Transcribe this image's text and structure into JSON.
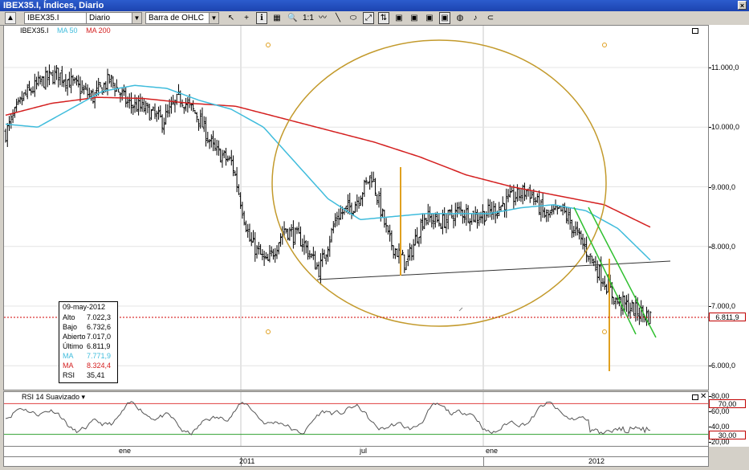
{
  "window": {
    "title": "IBEX35.I, Índices, Diario",
    "close_glyph": "×"
  },
  "toolbar": {
    "symbol": "IBEX35.I",
    "period": "Diario",
    "chart_type": "Barra de OHLC",
    "tool_glyphs": [
      "↖",
      "+",
      "ℹ",
      "▦",
      "🔍",
      "1:1",
      "〰",
      "╲",
      "⬭",
      "⤢",
      "⇅",
      "▣",
      "▣",
      "▣",
      "▣",
      "◍",
      "♪",
      "⊂"
    ]
  },
  "legend": {
    "symbol": "IBEX35.I",
    "ma50": "MA 50",
    "ma200": "MA 200",
    "ma50_color": "#3fbcdc",
    "ma200_color": "#d42020"
  },
  "infobox": {
    "date": "09-may-2012",
    "rows": [
      {
        "label": "Alto",
        "value": "7.022,3",
        "color": "#000000"
      },
      {
        "label": "Bajo",
        "value": "6.732,6",
        "color": "#000000"
      },
      {
        "label": "Abierto",
        "value": "7.017,0",
        "color": "#000000"
      },
      {
        "label": "Último",
        "value": "6.811,9",
        "color": "#000000"
      },
      {
        "label": "MA",
        "value": "7.771,9",
        "color": "#3fbcdc"
      },
      {
        "label": "MA",
        "value": "8.324,4",
        "color": "#d42020"
      },
      {
        "label": "RSI",
        "value": "35,41",
        "color": "#000000"
      }
    ]
  },
  "rsi_panel": {
    "title": "RSI 14 Suavizado"
  },
  "chart_data": [
    {
      "type": "ohlc",
      "ylim": [
        5600,
        11700
      ],
      "y_ticks": [
        "11.000,0",
        "10.000,0",
        "9.000,0",
        "8.000,0",
        "7.000,0",
        "6.000,0"
      ],
      "y_tick_values": [
        11000,
        10000,
        9000,
        8000,
        7000,
        6000
      ],
      "last_price": "6.811,9",
      "last_value": 6811.9,
      "x_month_labels": [
        "ene",
        "jul",
        "ene"
      ],
      "x_year_labels": [
        "2011",
        "2012"
      ],
      "series": [
        {
          "name": "IBEX35.I",
          "anchor_closes": [
            9900,
            10500,
            10750,
            10900,
            10700,
            10500,
            10800,
            10400,
            10300,
            10100,
            10500,
            10200,
            9600,
            9400,
            8100,
            7700,
            8300,
            8100,
            7600,
            8500,
            8700,
            9200,
            8100,
            7700,
            8500,
            8400,
            8600,
            8500,
            8600,
            8800,
            8950,
            8500,
            8600,
            8100,
            7600,
            7100,
            6950,
            6812
          ]
        },
        {
          "name": "MA 50",
          "anchor_values": [
            10050,
            10000,
            10300,
            10600,
            10700,
            10650,
            10450,
            10300,
            10000,
            9400,
            8800,
            8450,
            8500,
            8550,
            8550,
            8550,
            8650,
            8700,
            8600,
            8300,
            7772
          ]
        },
        {
          "name": "MA 200",
          "anchor_values": [
            10200,
            10400,
            10500,
            10480,
            10400,
            10350,
            10150,
            9950,
            9750,
            9500,
            9200,
            9000,
            8850,
            8700,
            8324
          ]
        }
      ]
    },
    {
      "type": "line",
      "ylim": [
        15,
        85
      ],
      "y_ticks": [
        "80,00",
        "60,00",
        "40,00",
        "20,00"
      ],
      "y_tick_values": [
        80,
        60,
        40,
        20
      ],
      "levels": [
        "70,00",
        "30,00"
      ],
      "level_values": [
        70,
        30
      ],
      "series": [
        {
          "name": "RSI 14 Suavizado",
          "last_value": 35.41
        }
      ]
    }
  ]
}
